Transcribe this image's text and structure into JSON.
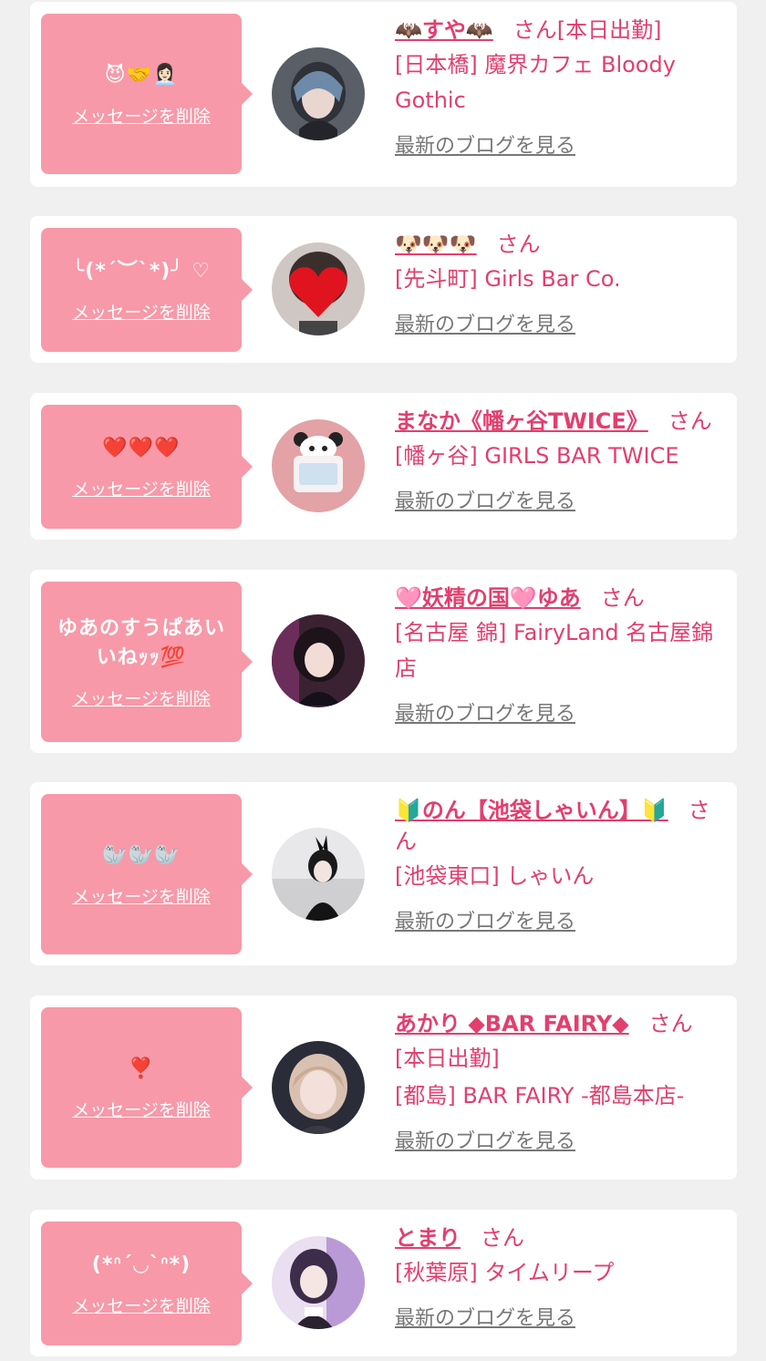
{
  "cards": [
    {
      "message": "😈🤝👩🏻‍💼",
      "delete_label": "メッセージを削除",
      "name": "🦇すや🦇",
      "name_suffix": "さん[本日出勤]",
      "shop": "[日本橋] 魔界カフェ Bloody Gothic",
      "blog_label": "最新のブログを見る",
      "avatar_icon": "avatar-gothic-girl"
    },
    {
      "message": "╰(*´︶`*)╯ ♡",
      "delete_label": "メッセージを削除",
      "name": "🐶🐶🐶",
      "name_suffix": "さん",
      "shop": "[先斗町] Girls Bar Co.",
      "blog_label": "最新のブログを見る",
      "avatar_icon": "avatar-heart-face"
    },
    {
      "message": "❤️❤️❤️",
      "delete_label": "メッセージを削除",
      "name": "まなか《幡ヶ谷TWICE》",
      "name_suffix": "さん",
      "shop": "[幡ヶ谷] GIRLS BAR TWICE",
      "blog_label": "最新のブログを見る",
      "avatar_icon": "avatar-panda"
    },
    {
      "message": "ゆあのすうぱあいいねｯｯ💯",
      "delete_label": "メッセージを削除",
      "name": "🩷妖精の国🩷ゆあ",
      "name_suffix": "さん",
      "shop": "[名古屋 錦] FairyLand 名古屋錦店",
      "blog_label": "最新のブログを見る",
      "avatar_icon": "avatar-girl-dark"
    },
    {
      "message": "🦭🦭🦭",
      "delete_label": "メッセージを削除",
      "name": "🔰のん【池袋しゃいん】🔰",
      "name_suffix": "さん",
      "shop": "[池袋東口] しゃいん",
      "blog_label": "最新のブログを見る",
      "avatar_icon": "avatar-bunny-girl"
    },
    {
      "message": "❣️",
      "delete_label": "メッセージを削除",
      "name": "あかり ◆BAR FAIRY◆",
      "name_suffix": "さん",
      "status": "[本日出勤]",
      "shop": "[都島] BAR FAIRY -都島本店-",
      "blog_label": "最新のブログを見る",
      "avatar_icon": "avatar-girl-blonde"
    },
    {
      "message": "(*ᐢ´◡`ᐢ*)",
      "delete_label": "メッセージを削除",
      "name": "とまり",
      "name_suffix": "さん",
      "shop": "[秋葉原] タイムリープ",
      "blog_label": "最新のブログを見る",
      "avatar_icon": "avatar-maid-girl"
    }
  ],
  "colors": {
    "bubble": "#f799a8",
    "accent": "#e23f6e",
    "link_gray": "#777777",
    "page_bg": "#f0f0f0"
  }
}
